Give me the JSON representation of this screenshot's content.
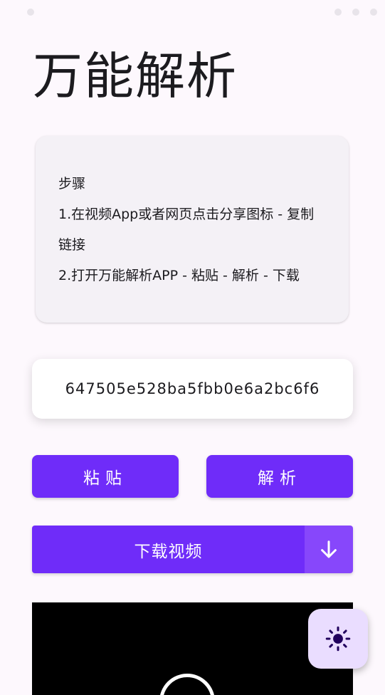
{
  "page": {
    "title": "万能解析"
  },
  "steps": {
    "heading": "步骤",
    "step1": "1.在视频App或者网页点击分享图标 - 复制链接",
    "step2": "2.打开万能解析APP - 粘贴 - 解析 - 下载"
  },
  "link_input": {
    "value": "647505e528ba5fbb0e6a2bc6f6"
  },
  "actions": {
    "paste_label": "粘贴",
    "parse_label": "解析",
    "download_label": "下载视频",
    "download_menu_icon": "arrow-down-icon"
  },
  "video": {
    "play_icon": "play-icon"
  },
  "fab": {
    "icon": "sun-icon"
  },
  "colors": {
    "primary": "#6f2cf9",
    "primary_light": "#8747fb",
    "fab_background": "#eaddff",
    "fab_icon": "#21005d",
    "background": "#fdf8fd",
    "card": "#f4f1f6"
  }
}
